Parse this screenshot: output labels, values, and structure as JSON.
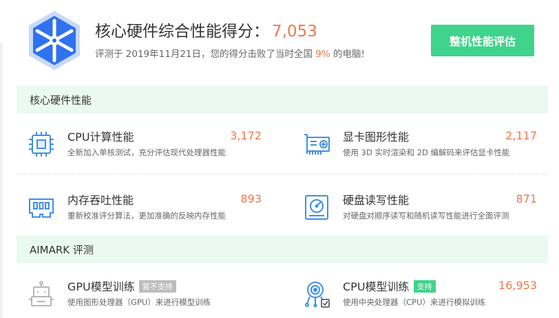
{
  "header": {
    "title": "核心硬件综合性能得分：",
    "score": "7,053",
    "sub_prefix": "评测于 2019年11月21日，您的得分击败了当时全国 ",
    "sub_pct": "9%",
    "sub_suffix": " 的电脑!",
    "button_label": "整机性能评估"
  },
  "sections": {
    "core": "核心硬件性能",
    "aimark": "AIMARK 评测"
  },
  "core_cards": {
    "cpu": {
      "title": "CPU计算性能",
      "value": "3,172",
      "desc": "全新加入单核测试，充分评估现代处理器性能",
      "icon": "cpu-chip-icon"
    },
    "gpu": {
      "title": "显卡图形性能",
      "value": "2,117",
      "desc": "使用 3D 实时渲染和 2D 编解码来评估显卡性能",
      "icon": "graphics-card-icon"
    },
    "mem": {
      "title": "内存吞吐性能",
      "value": "893",
      "desc": "重新校准评分算法，更加准确的反映内存性能",
      "icon": "memory-stick-icon"
    },
    "disk": {
      "title": "硬盘读写性能",
      "value": "871",
      "desc": "对硬盘对顺序读写和随机读写性能进行全面评测",
      "icon": "hard-drive-icon"
    }
  },
  "ai_cards": {
    "gpu_train": {
      "title": "GPU模型训练",
      "tag": "暂不支持",
      "desc": "使用图形处理器（GPU）来进行模型训练",
      "icon": "robot-icon"
    },
    "cpu_train": {
      "title": "CPU模型训练",
      "tag": "支持",
      "value": "16,953",
      "desc": "使用中央处理器（CPU）来进行模拟训练",
      "icon": "neural-brain-icon"
    }
  },
  "colors": {
    "accent_green": "#3fd38b",
    "score_orange": "#f0784a",
    "icon_blue": "#3d8ee8",
    "section_bg": "#eafaf1"
  }
}
